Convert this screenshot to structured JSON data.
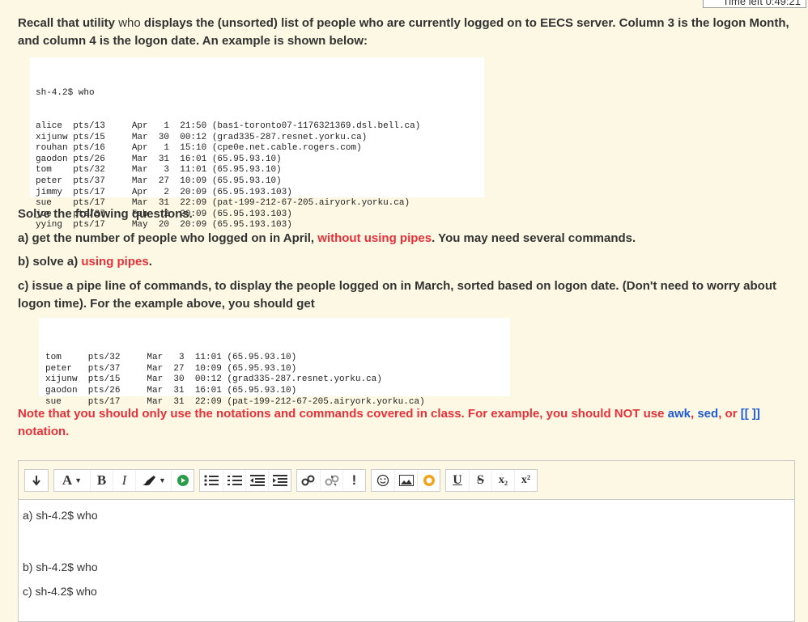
{
  "timer": "Time left 0:49:21",
  "question": {
    "intro_parts": [
      "Recall that utility ",
      "who displays the (unsorted) list of people who are currently logged on to EECS server. Column 3 is the logon Month, and column 4 is the logon date.  An example is shown below:"
    ],
    "intro_normal": "who",
    "example_command": "sh-4.2$ who",
    "example_rows": [
      [
        "alice",
        "pts/13",
        "Apr",
        "1",
        "21:50",
        "(bas1-toronto07-1176321369.dsl.bell.ca)"
      ],
      [
        "xijunw",
        "pts/15",
        "Mar",
        "30",
        "00:12",
        "(grad335-287.resnet.yorku.ca)"
      ],
      [
        "rouhan",
        "pts/16",
        "Apr",
        "1",
        "15:10",
        "(cpe0e.net.cable.rogers.com)"
      ],
      [
        "gaodon",
        "pts/26",
        "Mar",
        "31",
        "16:01",
        "(65.95.93.10)"
      ],
      [
        "tom",
        "pts/32",
        "Mar",
        "3",
        "11:01",
        "(65.95.93.10)"
      ],
      [
        "peter",
        "pts/37",
        "Mar",
        "27",
        "10:09",
        "(65.95.93.10)"
      ],
      [
        "jimmy",
        "pts/17",
        "Apr",
        "2",
        "20:09",
        "(65.95.193.103)"
      ],
      [
        "sue",
        "pts/17",
        "Mar",
        "31",
        "22:09",
        "(pat-199-212-67-205.airyork.yorku.ca)"
      ],
      [
        "joe",
        "pts/37",
        "Feb",
        "2",
        "20:09",
        "(65.95.193.103)"
      ],
      [
        "yying",
        "pts/17",
        "May",
        "20",
        "20:09",
        "(65.95.193.103)"
      ]
    ],
    "solve_heading": "Solve the following questions.",
    "qa_start": "a) get the number of people who logged on in April, ",
    "qa_red": "without using pipes",
    "qa_end": ". You may need several commands.",
    "qb_start": "b) solve a) ",
    "qb_red": "using pipes",
    "qb_end": ".",
    "qc": "c) issue a pipe line of commands, to display the people logged on in March, sorted based on logon date. (Don't need to worry about logon time). For the example above, you should get",
    "result_rows": [
      [
        "tom",
        "pts/32",
        "Mar",
        "3",
        "11:01",
        "(65.95.93.10)"
      ],
      [
        "peter",
        "pts/37",
        "Mar",
        "27",
        "10:09",
        "(65.95.93.10)"
      ],
      [
        "xijunw",
        "pts/15",
        "Mar",
        "30",
        "00:12",
        "(grad335-287.resnet.yorku.ca)"
      ],
      [
        "gaodon",
        "pts/26",
        "Mar",
        "31",
        "16:01",
        "(65.95.93.10)"
      ],
      [
        "sue",
        "pts/17",
        "Mar",
        "31",
        "22:09",
        "(pat-199-212-67-205.airyork.yorku.ca)"
      ]
    ],
    "note_start": "Note that you should only use the notations and commands covered in class. For example, you should NOT use ",
    "note_awk": "awk",
    "note_comma1": ", ",
    "note_sed": "sed",
    "note_or": ", or ",
    "note_brackets": "[[ ]]",
    "note_end": " notation."
  },
  "toolbar": {
    "font_label": "A",
    "bold_label": "B",
    "italic_label": "I",
    "special_char": "!",
    "underline_label": "U",
    "strike_label": "S",
    "subscript_label": "x₂",
    "superscript_label": "x²"
  },
  "answer_lines": [
    "a) sh-4.2$ who",
    "",
    "",
    "b) sh-4.2$ who",
    "c) sh-4.2$ who"
  ]
}
